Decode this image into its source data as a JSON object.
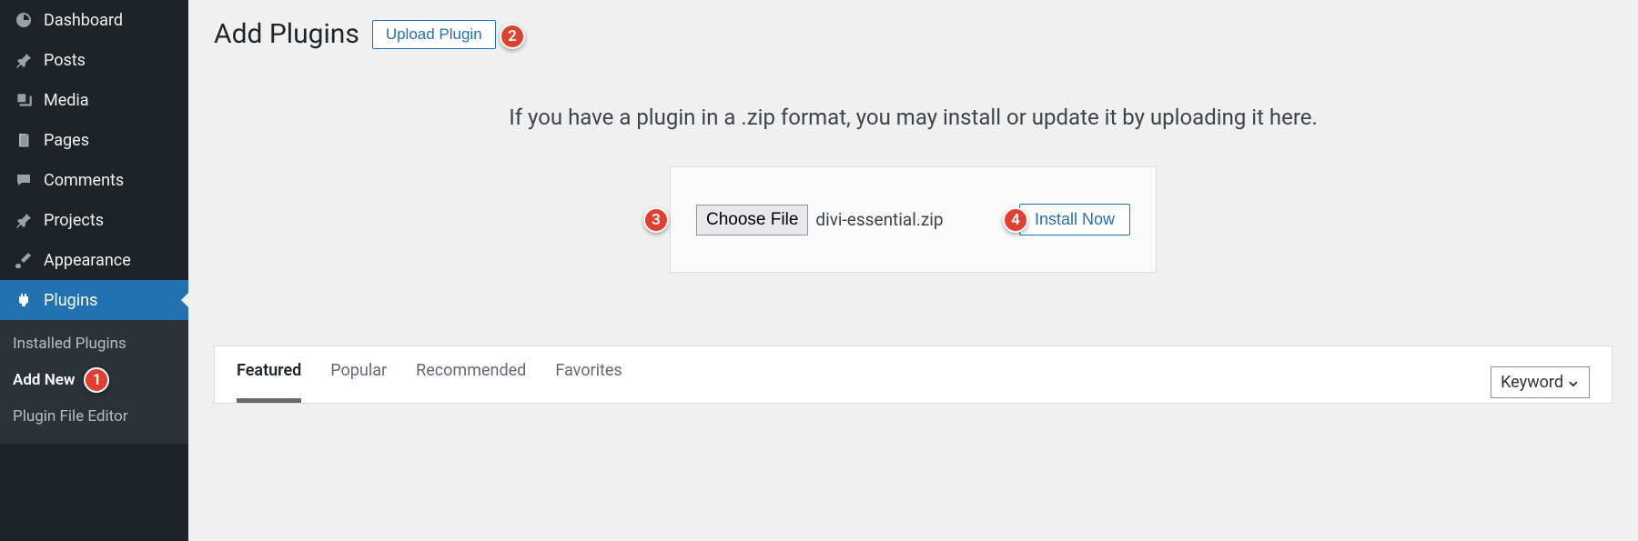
{
  "sidebar": {
    "items": [
      {
        "label": "Dashboard"
      },
      {
        "label": "Posts"
      },
      {
        "label": "Media"
      },
      {
        "label": "Pages"
      },
      {
        "label": "Comments"
      },
      {
        "label": "Projects"
      },
      {
        "label": "Appearance"
      },
      {
        "label": "Plugins"
      }
    ],
    "submenu": [
      {
        "label": "Installed Plugins"
      },
      {
        "label": "Add New"
      },
      {
        "label": "Plugin File Editor"
      }
    ]
  },
  "header": {
    "title": "Add Plugins",
    "upload_btn": "Upload Plugin"
  },
  "upload": {
    "description": "If you have a plugin in a .zip format, you may install or update it by uploading it here.",
    "choose_file": "Choose File",
    "filename": "divi-essential.zip",
    "install_btn": "Install Now"
  },
  "tabs": [
    "Featured",
    "Popular",
    "Recommended",
    "Favorites"
  ],
  "search_type": "Keyword",
  "callouts": {
    "c1": "1",
    "c2": "2",
    "c3": "3",
    "c4": "4"
  }
}
